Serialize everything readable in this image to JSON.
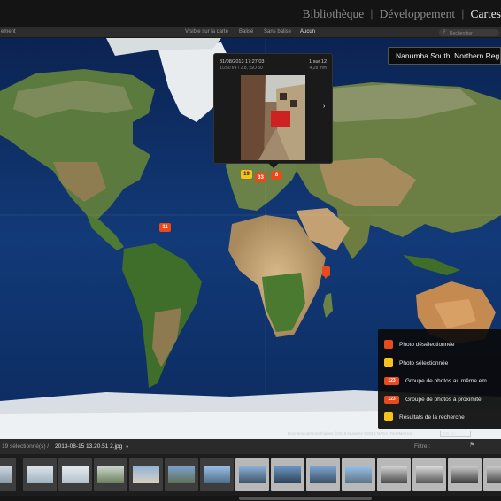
{
  "modules": {
    "library": "Bibliothèque",
    "develop": "Développement",
    "map": "Cartes"
  },
  "filter_bar": {
    "left_label": "ement",
    "visible_on_map": "Visible sur la carte",
    "tagged": "Balisé",
    "untagged": "Sans balise",
    "none": "Aucun",
    "search_placeholder": "Rechercher"
  },
  "location": "Nanumba South, Northern Reg",
  "popup": {
    "date": "31/08/2013 17:27:03",
    "exposure": "1/250 f/4 / 2.8, ISO 50",
    "count": "1 sur 12",
    "focal": "4,28 mm"
  },
  "markers": [
    {
      "label": "19",
      "color": "yellow"
    },
    {
      "label": "33",
      "color": "orange"
    },
    {
      "label": "8",
      "color": "orange"
    },
    {
      "label": "11",
      "color": "orange"
    }
  ],
  "legend": [
    {
      "label": "Photo désélectionnée",
      "icon": "orange-pin-icon",
      "color": "#e84a1c"
    },
    {
      "label": "Photo sélectionnée",
      "icon": "yellow-pin-icon",
      "color": "#f7c21a"
    },
    {
      "label": "Groupe de photos au même em",
      "icon": "orange-cluster-icon",
      "badge": "123",
      "color": "#e84a1c"
    },
    {
      "label": "Groupe de photos à proximité",
      "icon": "orange-cluster-icon",
      "badge": "123",
      "color": "#e84a1c"
    },
    {
      "label": "Résultats de la recherche",
      "icon": "search-result-pin-icon",
      "color": "#f7c21a"
    }
  ],
  "attribution": "Données cartographiques ©2018 Imagerie ©2018 NASA, TerraMetrics",
  "scale": "500 km",
  "filmstrip": {
    "selection_info": "19 sélectionné(s) /",
    "current_file": "2013-08-15 13.20.51 2.jpg",
    "filter_label": "Filtre :"
  },
  "colors": {
    "ocean": "#0e2a5c",
    "accent_orange": "#e84a1c",
    "accent_yellow": "#f7c21a"
  }
}
